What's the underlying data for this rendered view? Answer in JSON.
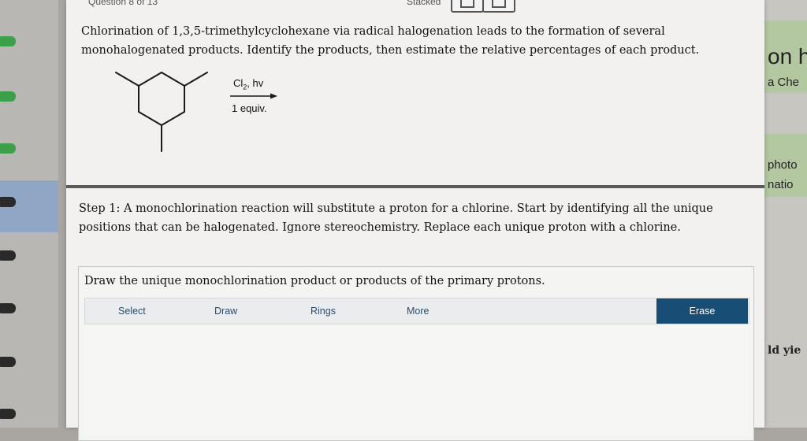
{
  "header": {
    "fragment_left": "Question 8 of 13",
    "fragment_right": "Stacked"
  },
  "question": {
    "text": "Chlorination of 1,3,5-trimethylcyclohexane via radical halogenation leads to the formation of several monohalogenated products. Identify the products, then estimate the relative percentages of each product."
  },
  "reaction": {
    "reagent_main": "Cl",
    "reagent_sub": "2",
    "reagent_tail": ", hv",
    "equiv": "1 equiv."
  },
  "step": {
    "text": "Step 1: A monochlorination reaction will substitute a proton for a chlorine. Start by identifying all the unique positions that can be halogenated. Ignore stereochemistry. Replace each unique proton with a chlorine."
  },
  "draw_area": {
    "prompt": "Draw the unique monochlorination product or products of the primary protons.",
    "tools": {
      "select": "Select",
      "draw": "Draw",
      "rings": "Rings",
      "more": "More",
      "erase": "Erase"
    }
  },
  "right_fragments": {
    "t1": "on h",
    "t2": "a Che",
    "t3": "photo",
    "t4": "natio",
    "t5": "ld yie"
  },
  "colors": {
    "erase_bg": "#184d76",
    "tool_text": "#2b4d6c",
    "tab_green": "#3ca04a"
  }
}
